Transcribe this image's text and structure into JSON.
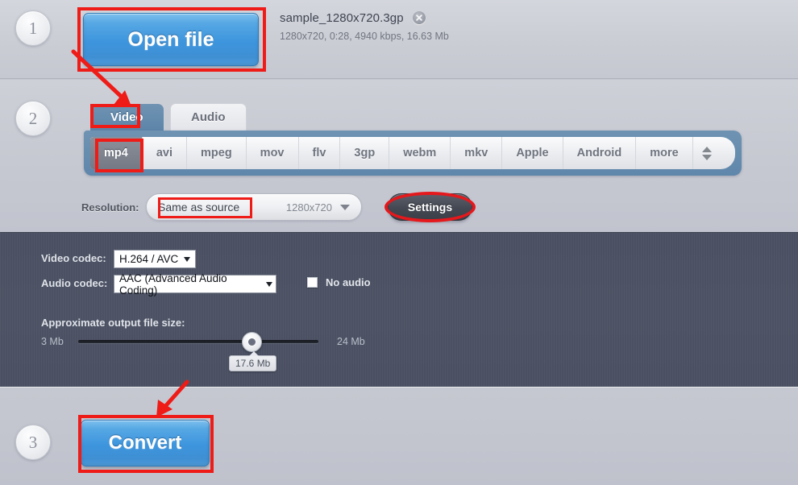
{
  "steps": {
    "one": "1",
    "two": "2",
    "three": "3"
  },
  "step1": {
    "open_file_label": "Open file",
    "file_name": "sample_1280x720.3gp",
    "file_meta": "1280x720, 0:28, 4940 kbps, 16.63 Mb",
    "remove_icon": "close-circle-icon"
  },
  "step2": {
    "tabs": [
      {
        "label": "Video",
        "active": true
      },
      {
        "label": "Audio",
        "active": false
      }
    ],
    "formats": [
      {
        "label": "mp4",
        "active": true
      },
      {
        "label": "avi",
        "active": false
      },
      {
        "label": "mpeg",
        "active": false
      },
      {
        "label": "mov",
        "active": false
      },
      {
        "label": "flv",
        "active": false
      },
      {
        "label": "3gp",
        "active": false
      },
      {
        "label": "webm",
        "active": false
      },
      {
        "label": "mkv",
        "active": false
      },
      {
        "label": "Apple",
        "active": false
      },
      {
        "label": "Android",
        "active": false
      },
      {
        "label": "more",
        "active": false
      }
    ],
    "resolution_label": "Resolution:",
    "resolution_value": "Same as source",
    "resolution_source": "1280x720",
    "settings_label": "Settings"
  },
  "settings": {
    "video_codec_label": "Video codec:",
    "video_codec_value": "H.264 / AVC",
    "video_codec_options": [
      "H.264 / AVC"
    ],
    "audio_codec_label": "Audio codec:",
    "audio_codec_value": "AAC (Advanced Audio Coding)",
    "audio_codec_options": [
      "AAC (Advanced Audio Coding)"
    ],
    "no_audio_label": "No audio",
    "no_audio_checked": false,
    "size_label": "Approximate output file size:",
    "size_min": "3 Mb",
    "size_max": "24 Mb",
    "size_current": "17.6 Mb"
  },
  "step3": {
    "convert_label": "Convert"
  },
  "annotation": {
    "color": "#ee1b17",
    "highlight_targets": [
      "Open file",
      "Video",
      "mp4",
      "Same as source",
      "Settings",
      "Convert"
    ]
  },
  "colors": {
    "accent_blue": "#3d95dd",
    "tab_blue": "#5d85a9",
    "panel_dark": "#4c5264",
    "page_bg": "#c6c8d1",
    "annotation_red": "#ee1b17"
  }
}
